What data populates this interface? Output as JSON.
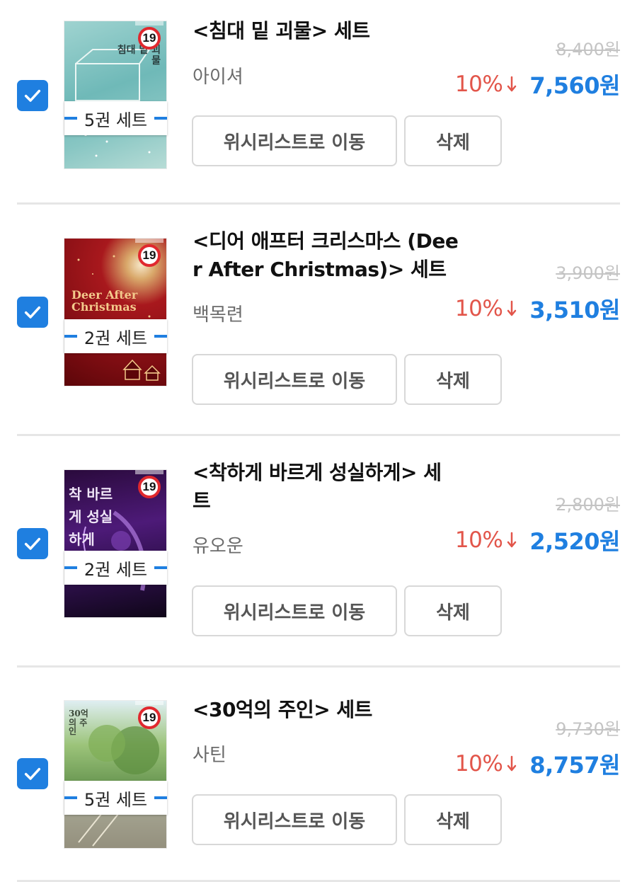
{
  "items": [
    {
      "title_line1": "<침대 밑 괴물> 세트",
      "title_line2": "",
      "author": "아이셔",
      "set_label": "5권 세트",
      "original_price": "8,400원",
      "discount": "10%",
      "price": "7,560원",
      "cover_text": "침대 밑 괴물",
      "age_rating": "19",
      "checked": true
    },
    {
      "title_line1": "<디어 애프터 크리스마스 (Dee",
      "title_line2": "r After Christmas)> 세트",
      "author": "백목련",
      "set_label": "2권 세트",
      "original_price": "3,900원",
      "discount": "10%",
      "price": "3,510원",
      "cover_text": "Deer After Christmas",
      "age_rating": "19",
      "checked": true
    },
    {
      "title_line1": "<착하게 바르게 성실하게> 세",
      "title_line2": "트",
      "author": "유오운",
      "set_label": "2권 세트",
      "original_price": "2,800원",
      "discount": "10%",
      "price": "2,520원",
      "cover_text": "착 바르게 성실 하게",
      "age_rating": "19",
      "checked": true
    },
    {
      "title_line1": "<30억의 주인> 세트",
      "title_line2": "",
      "author": "사틴",
      "set_label": "5권 세트",
      "original_price": "9,730원",
      "discount": "10%",
      "price": "8,757원",
      "cover_text": "30억의 주인",
      "age_rating": "19",
      "checked": true
    }
  ],
  "buttons": {
    "wishlist": "위시리스트로 이동",
    "delete": "삭제"
  },
  "colors": {
    "accent_blue": "#1f7fe0",
    "discount_red": "#e2554a",
    "strikethrough_gray": "#c4c4c4",
    "age_badge_red": "#e0282e"
  },
  "icons": {
    "checkbox": "checkmark-icon",
    "discount_arrow": "arrow-down-icon",
    "age_badge": "age-19-badge-icon"
  }
}
